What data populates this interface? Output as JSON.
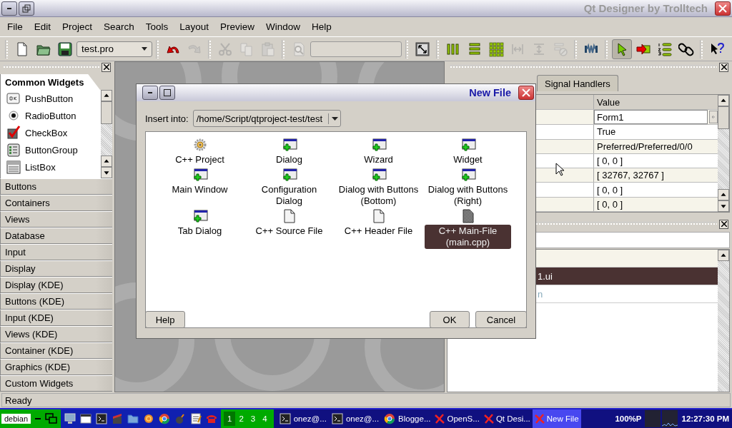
{
  "window": {
    "title": "Qt Designer by Trolltech"
  },
  "menu": [
    "File",
    "Edit",
    "Project",
    "Search",
    "Tools",
    "Layout",
    "Preview",
    "Window",
    "Help"
  ],
  "toolbar": [
    [
      {
        "kind": "new",
        "disabled": false
      },
      {
        "kind": "open",
        "disabled": false
      },
      {
        "kind": "save",
        "disabled": false
      },
      {
        "kind": "combo",
        "value": "test.pro"
      }
    ],
    [
      {
        "kind": "undo",
        "disabled": false
      },
      {
        "kind": "redo",
        "disabled": true
      }
    ],
    [
      {
        "kind": "cut",
        "disabled": true
      },
      {
        "kind": "copy",
        "disabled": true
      },
      {
        "kind": "paste",
        "disabled": true
      }
    ],
    [
      {
        "kind": "find",
        "disabled": true
      },
      {
        "kind": "field",
        "disabled": true
      }
    ],
    [
      {
        "kind": "adjust",
        "disabled": false
      }
    ],
    [
      {
        "kind": "hlayout",
        "disabled": false
      },
      {
        "kind": "vlayout",
        "disabled": false
      },
      {
        "kind": "grid",
        "disabled": false
      },
      {
        "kind": "splith",
        "disabled": true
      },
      {
        "kind": "splitv",
        "disabled": true
      },
      {
        "kind": "break",
        "disabled": true
      }
    ],
    [
      {
        "kind": "spacer",
        "disabled": false
      }
    ],
    [
      {
        "kind": "pointer",
        "disabled": false,
        "selected": true
      },
      {
        "kind": "connect",
        "disabled": false,
        "selected": false
      },
      {
        "kind": "taborder",
        "disabled": false,
        "selected": false
      },
      {
        "kind": "buddy",
        "disabled": false,
        "selected": false
      }
    ],
    [
      {
        "kind": "whatsthis",
        "disabled": false
      }
    ]
  ],
  "toolbox": {
    "sections": [
      {
        "label": "Common Widgets",
        "selected": true,
        "items": [
          {
            "kind": "pushbutton",
            "label": "PushButton"
          },
          {
            "kind": "radiobutton",
            "label": "RadioButton"
          },
          {
            "kind": "checkbox",
            "label": "CheckBox"
          },
          {
            "kind": "buttongroup",
            "label": "ButtonGroup"
          },
          {
            "kind": "listbox",
            "label": "ListBox"
          }
        ]
      },
      {
        "label": "Buttons",
        "selected": false
      },
      {
        "label": "Containers",
        "selected": false
      },
      {
        "label": "Views",
        "selected": false
      },
      {
        "label": "Database",
        "selected": false
      },
      {
        "label": "Input",
        "selected": false
      },
      {
        "label": "Display",
        "selected": false
      },
      {
        "label": "Display (KDE)",
        "selected": false
      },
      {
        "label": "Buttons (KDE)",
        "selected": false
      },
      {
        "label": "Input (KDE)",
        "selected": false
      },
      {
        "label": "Views (KDE)",
        "selected": false
      },
      {
        "label": "Container (KDE)",
        "selected": false
      },
      {
        "label": "Graphics (KDE)",
        "selected": false
      },
      {
        "label": "Custom Widgets",
        "selected": false
      }
    ]
  },
  "property_editor": {
    "tabs": [
      {
        "label": "Signal Handlers",
        "selected": false
      }
    ],
    "value_column": "Value",
    "rows": [
      {
        "kind": "edit",
        "value": "Form1"
      },
      {
        "kind": "text",
        "value": "True"
      },
      {
        "kind": "text",
        "value": "Preferred/Preferred/0/0"
      },
      {
        "kind": "text",
        "value": "[ 0, 0 ]"
      },
      {
        "kind": "text",
        "value": "[ 32767, 32767 ]"
      },
      {
        "kind": "text",
        "value": "[ 0, 0 ]"
      },
      {
        "kind": "text",
        "value": "[ 0, 0 ]"
      }
    ]
  },
  "object_explorer": {
    "rows": [
      {
        "text": "1.ui",
        "selected": true
      },
      {
        "text": "n",
        "selected": false
      }
    ]
  },
  "dialog": {
    "title": "New File",
    "insert_label": "Insert into:",
    "insert_value": "/home/Script/qtproject-test/test",
    "items": [
      {
        "kind": "project",
        "label": "C++ Project",
        "selected": false
      },
      {
        "kind": "form",
        "label": "Dialog",
        "selected": false
      },
      {
        "kind": "form",
        "label": "Wizard",
        "selected": false
      },
      {
        "kind": "form",
        "label": "Widget",
        "selected": false
      },
      {
        "kind": "form",
        "label": "Main Window",
        "selected": false
      },
      {
        "kind": "form",
        "label": "Configuration Dialog",
        "selected": false
      },
      {
        "kind": "form",
        "label": "Dialog with Buttons (Bottom)",
        "selected": false
      },
      {
        "kind": "form",
        "label": "Dialog with Buttons (Right)",
        "selected": false
      },
      {
        "kind": "form",
        "label": "Tab Dialog",
        "selected": false
      },
      {
        "kind": "file",
        "label": "C++ Source File",
        "selected": false
      },
      {
        "kind": "file",
        "label": "C++ Header File",
        "selected": false
      },
      {
        "kind": "main",
        "label": "C++ Main-File (main.cpp)",
        "selected": true
      }
    ],
    "left_buttons": [
      "Help"
    ],
    "right_buttons": [
      "OK",
      "Cancel"
    ]
  },
  "status_bar": "Ready",
  "taskbar": {
    "start_label": "debian",
    "workspaces": [
      {
        "label": "1",
        "selected": true
      },
      {
        "label": "2",
        "selected": false
      },
      {
        "label": "3",
        "selected": false
      },
      {
        "label": "4",
        "selected": false
      }
    ],
    "tasks": [
      {
        "label": "onez@...",
        "selected": false
      },
      {
        "label": "onez@...",
        "selected": false
      },
      {
        "label": "Blogge...",
        "selected": false
      },
      {
        "label": "OpenS...",
        "selected": false
      },
      {
        "label": "Qt Desi...",
        "selected": false
      },
      {
        "label": "New File",
        "selected": true
      }
    ],
    "battery": "100%P",
    "clock": "12:27:30 PM"
  }
}
